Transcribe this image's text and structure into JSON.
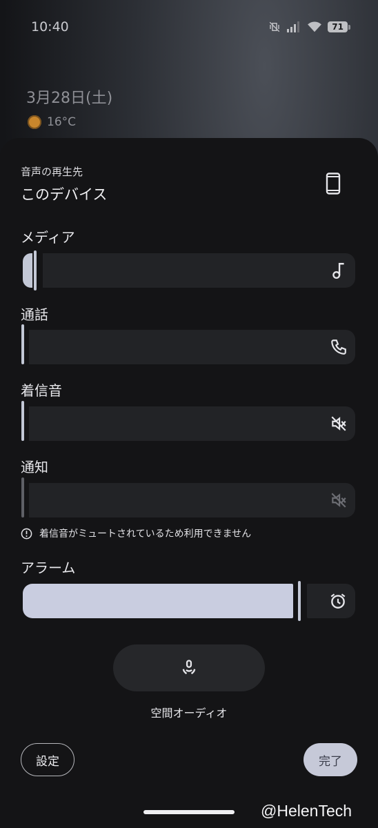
{
  "status_bar": {
    "time": "10:40",
    "battery": "71",
    "icons": [
      "vibrate-off-icon",
      "signal-icon",
      "wifi-icon",
      "battery-icon"
    ]
  },
  "lockscreen": {
    "date": "3月28日(土)",
    "temperature": "16°C"
  },
  "panel": {
    "output_label": "音声の再生先",
    "output_device": "このデバイス",
    "sliders": {
      "media": {
        "label": "メディア",
        "icon": "music-note-icon",
        "level": 0.03
      },
      "call": {
        "label": "通話",
        "icon": "phone-call-icon",
        "level": 0.0
      },
      "ring": {
        "label": "着信音",
        "icon": "ringer-muted-icon",
        "level": 0.0
      },
      "notification": {
        "label": "通知",
        "icon": "notification-muted-icon",
        "level": 0.0,
        "disabled": true
      },
      "alarm": {
        "label": "アラーム",
        "icon": "alarm-clock-icon",
        "level": 0.82
      }
    },
    "warning": "着信音がミュートされているため利用できません",
    "spatial_audio": "空間オーディオ",
    "settings_button": "設定",
    "done_button": "完了"
  },
  "watermark": "@HelenTech",
  "colors": {
    "accent": "#c6c9d8",
    "track": "#222326",
    "sheet": "#141416"
  }
}
